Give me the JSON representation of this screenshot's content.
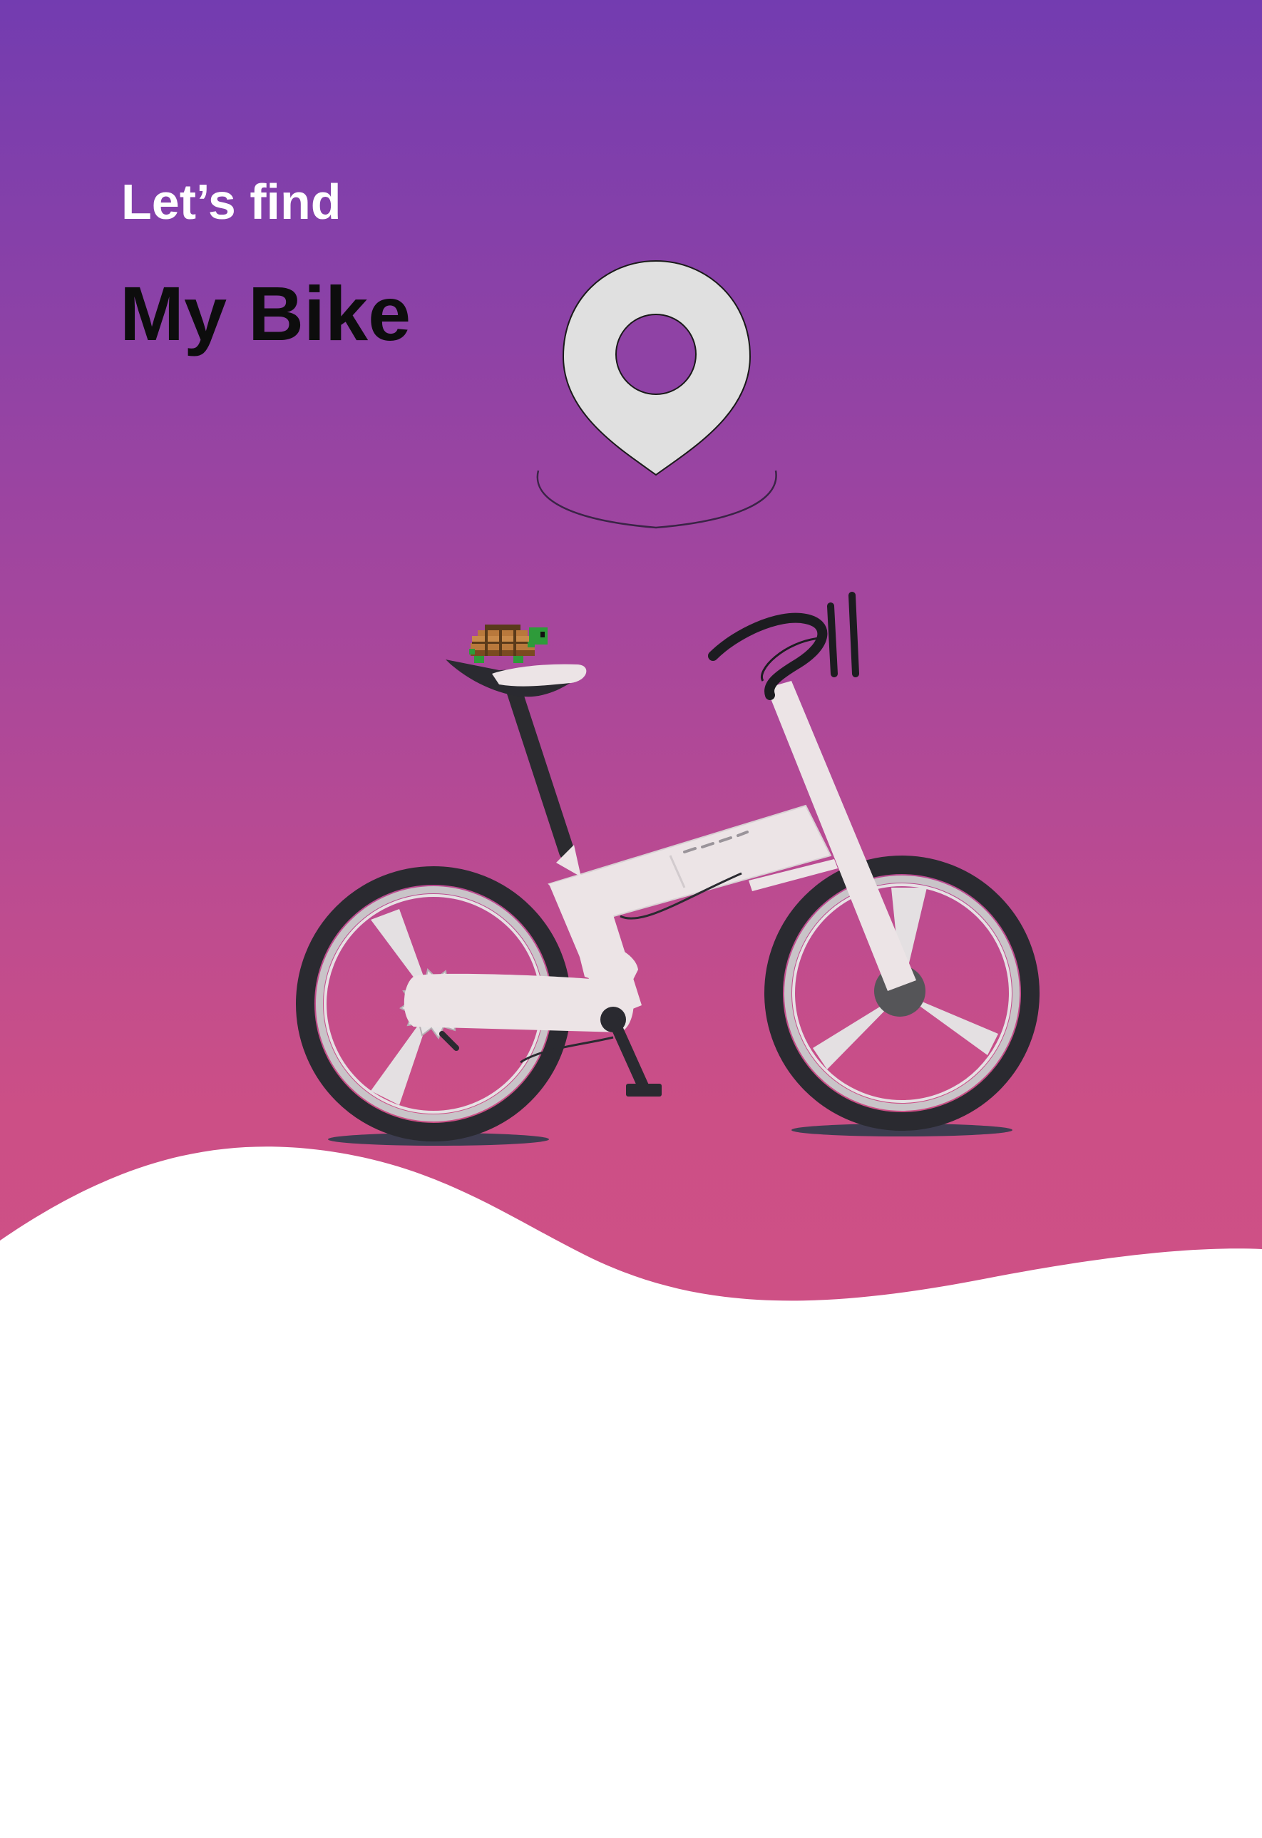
{
  "header": {
    "subtitle": "Let’s find",
    "title": "My Bike"
  },
  "icons": {
    "pin": "location-pin-icon",
    "bike": "bicycle-illustration",
    "turtle": "turtle-icon"
  },
  "colors": {
    "gradient_top": "#733cb0",
    "gradient_bottom": "#cf5085",
    "bike_frame": "#ece4e6",
    "pin_fill": "#e0e0e0",
    "title_color": "#0d0d0d",
    "subtitle_color": "#ffffff"
  }
}
